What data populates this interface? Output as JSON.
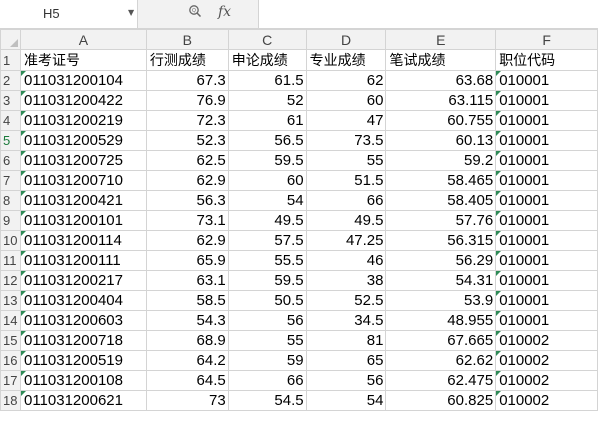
{
  "name_box": {
    "value": "H5"
  },
  "formula_bar": {
    "fx_label": "fx",
    "value": ""
  },
  "columns": [
    "A",
    "B",
    "C",
    "D",
    "E",
    "F"
  ],
  "header_row": {
    "row_number": "1",
    "cells": [
      "准考证号",
      "行测成绩",
      "申论成绩",
      "专业成绩",
      "笔试成绩",
      "职位代码"
    ]
  },
  "rows": [
    {
      "n": "2",
      "cells": [
        "011031200104",
        "67.3",
        "61.5",
        "62",
        "63.68",
        "010001"
      ]
    },
    {
      "n": "3",
      "cells": [
        "011031200422",
        "76.9",
        "52",
        "60",
        "63.115",
        "010001"
      ]
    },
    {
      "n": "4",
      "cells": [
        "011031200219",
        "72.3",
        "61",
        "47",
        "60.755",
        "010001"
      ]
    },
    {
      "n": "5",
      "cells": [
        "011031200529",
        "52.3",
        "56.5",
        "73.5",
        "60.13",
        "010001"
      ]
    },
    {
      "n": "6",
      "cells": [
        "011031200725",
        "62.5",
        "59.5",
        "55",
        "59.2",
        "010001"
      ]
    },
    {
      "n": "7",
      "cells": [
        "011031200710",
        "62.9",
        "60",
        "51.5",
        "58.465",
        "010001"
      ]
    },
    {
      "n": "8",
      "cells": [
        "011031200421",
        "56.3",
        "54",
        "66",
        "58.405",
        "010001"
      ]
    },
    {
      "n": "9",
      "cells": [
        "011031200101",
        "73.1",
        "49.5",
        "49.5",
        "57.76",
        "010001"
      ]
    },
    {
      "n": "10",
      "cells": [
        "011031200114",
        "62.9",
        "57.5",
        "47.25",
        "56.315",
        "010001"
      ]
    },
    {
      "n": "11",
      "cells": [
        "011031200111",
        "65.9",
        "55.5",
        "46",
        "56.29",
        "010001"
      ]
    },
    {
      "n": "12",
      "cells": [
        "011031200217",
        "63.1",
        "59.5",
        "38",
        "54.31",
        "010001"
      ]
    },
    {
      "n": "13",
      "cells": [
        "011031200404",
        "58.5",
        "50.5",
        "52.5",
        "53.9",
        "010001"
      ]
    },
    {
      "n": "14",
      "cells": [
        "011031200603",
        "54.3",
        "56",
        "34.5",
        "48.955",
        "010001"
      ]
    },
    {
      "n": "15",
      "cells": [
        "011031200718",
        "68.9",
        "55",
        "81",
        "67.665",
        "010002"
      ]
    },
    {
      "n": "16",
      "cells": [
        "011031200519",
        "64.2",
        "59",
        "65",
        "62.62",
        "010002"
      ]
    },
    {
      "n": "17",
      "cells": [
        "011031200108",
        "64.5",
        "66",
        "56",
        "62.475",
        "010002"
      ]
    },
    {
      "n": "18",
      "cells": [
        "011031200621",
        "73",
        "54.5",
        "54",
        "60.825",
        "010002"
      ]
    }
  ],
  "active_row": "5",
  "colors": {
    "header_bg": "#f2f2f2",
    "grid_line": "#d4d4d4",
    "text_marker": "#2e8b57"
  }
}
